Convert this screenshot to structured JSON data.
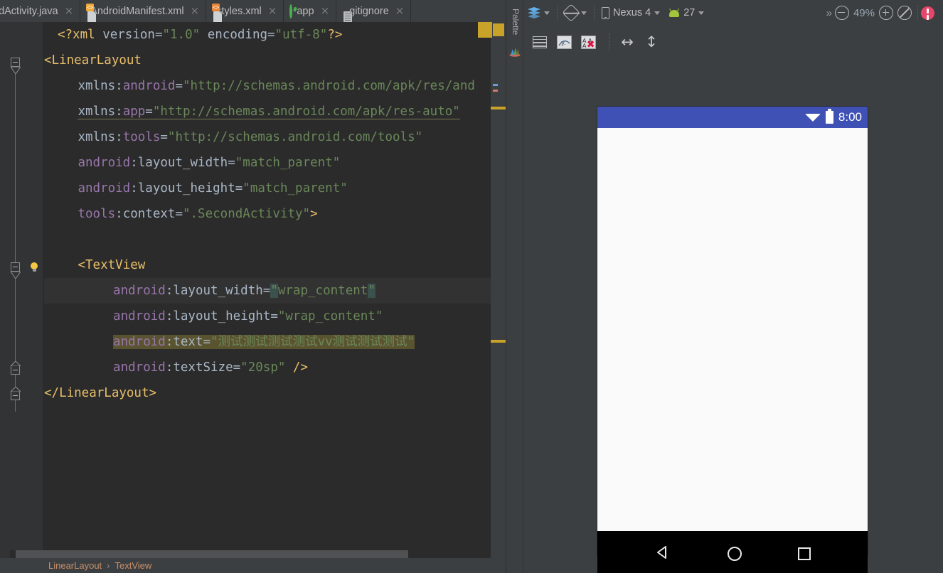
{
  "editor": {
    "tabs": [
      {
        "label": "ndActivity.java",
        "icon": "java-file-icon",
        "active": false,
        "truncated": true
      },
      {
        "label": "AndroidManifest.xml",
        "icon": "android-manifest-icon",
        "active": false
      },
      {
        "label": "styles.xml",
        "icon": "xml-resource-icon",
        "active": false
      },
      {
        "label": "app",
        "icon": "android-app-module-icon",
        "active": false
      },
      {
        "label": ".gitignore",
        "icon": "gitignore-file-icon",
        "active": false
      }
    ],
    "close_glyph": "×",
    "breadcrumb": {
      "items": [
        "LinearLayout",
        "TextView"
      ],
      "separator": "›"
    },
    "code_lines": [
      {
        "indent": 1,
        "segments": [
          {
            "t": "<?xml ",
            "c": "tag"
          },
          {
            "t": "version=",
            "c": "plain"
          },
          {
            "t": "\"1.0\"",
            "c": "str"
          },
          {
            "t": " encoding=",
            "c": "plain"
          },
          {
            "t": "\"utf-8\"",
            "c": "str"
          },
          {
            "t": "?>",
            "c": "tag"
          }
        ]
      },
      {
        "indent": 0,
        "segments": [
          {
            "t": "<LinearLayout",
            "c": "tag"
          }
        ]
      },
      {
        "indent": 2,
        "segments": [
          {
            "t": "xmlns:",
            "c": "plain"
          },
          {
            "t": "android",
            "c": "attr"
          },
          {
            "t": "=",
            "c": "plain"
          },
          {
            "t": "\"http://schemas.android.com/apk/res/and",
            "c": "str"
          }
        ]
      },
      {
        "indent": 2,
        "underline": "solid",
        "segments": [
          {
            "t": "xmlns:",
            "c": "plain"
          },
          {
            "t": "app",
            "c": "attr"
          },
          {
            "t": "=",
            "c": "plain"
          },
          {
            "t": "\"http://schemas.android.com/apk/res-auto\"",
            "c": "str"
          }
        ]
      },
      {
        "indent": 2,
        "segments": [
          {
            "t": "xmlns:",
            "c": "plain"
          },
          {
            "t": "tools",
            "c": "attr"
          },
          {
            "t": "=",
            "c": "plain"
          },
          {
            "t": "\"http://schemas.android.com/tools\"",
            "c": "str"
          }
        ]
      },
      {
        "indent": 2,
        "segments": [
          {
            "t": "android",
            "c": "attr"
          },
          {
            "t": ":layout_width=",
            "c": "plain"
          },
          {
            "t": "\"match_parent\"",
            "c": "str"
          }
        ]
      },
      {
        "indent": 2,
        "segments": [
          {
            "t": "android",
            "c": "attr"
          },
          {
            "t": ":layout_height=",
            "c": "plain"
          },
          {
            "t": "\"match_parent\"",
            "c": "str"
          }
        ]
      },
      {
        "indent": 2,
        "segments": [
          {
            "t": "tools",
            "c": "attr"
          },
          {
            "t": ":context=",
            "c": "plain"
          },
          {
            "t": "\".SecondActivity\"",
            "c": "str"
          },
          {
            "t": ">",
            "c": "tag"
          }
        ]
      },
      {
        "indent": 0,
        "segments": []
      },
      {
        "indent": 2,
        "bulb": true,
        "segments": [
          {
            "t": "<TextView",
            "c": "tag"
          }
        ]
      },
      {
        "indent": 3,
        "rowhl": "line",
        "segments": [
          {
            "t": "android",
            "c": "attr"
          },
          {
            "t": ":layout_width=",
            "c": "plain"
          },
          {
            "t": "\"",
            "c": "str",
            "hl": "brace"
          },
          {
            "t": "wrap_content",
            "c": "str"
          },
          {
            "t": "\"",
            "c": "str",
            "hl": "brace"
          }
        ]
      },
      {
        "indent": 3,
        "segments": [
          {
            "t": "android",
            "c": "attr"
          },
          {
            "t": ":layout_height=",
            "c": "plain"
          },
          {
            "t": "\"wrap_content\"",
            "c": "str"
          }
        ]
      },
      {
        "indent": 3,
        "rowhl": "warn",
        "segments": [
          {
            "t": "android",
            "c": "attr"
          },
          {
            "t": ":text=",
            "c": "plain"
          },
          {
            "t": "\"测试测试测试测试vv测试测试测试\"",
            "c": "str"
          }
        ]
      },
      {
        "indent": 3,
        "segments": [
          {
            "t": "android",
            "c": "attr"
          },
          {
            "t": ":textSize=",
            "c": "plain"
          },
          {
            "t": "\"20sp\"",
            "c": "str"
          },
          {
            "t": " />",
            "c": "tag"
          }
        ]
      },
      {
        "indent": 0,
        "segments": [
          {
            "t": "</LinearLayout>",
            "c": "tag"
          }
        ]
      }
    ]
  },
  "design": {
    "palette_label": "Palette",
    "toolbar": {
      "design_mode_icon": "layers-icon",
      "orientation_icon": "rotate-device-icon",
      "device_icon": "phone-icon",
      "device_name": "Nexus 4",
      "api_icon": "android-icon",
      "api_level": "27",
      "overflow_glyph": "»",
      "zoom_out_icon": "zoom-out-icon",
      "zoom_level": "49%",
      "zoom_in_icon": "zoom-in-icon",
      "zoom_fit_icon": "zoom-fit-icon",
      "error_badge_icon": "error-badge-icon"
    },
    "toolbar2": {
      "show_layout_decorations_icon": "layout-decorations-icon",
      "blueprint_icon": "blueprint-mode-icon",
      "blueprint_off_icon": "blueprint-off-icon",
      "match_width_icon": "expand-horizontal-icon",
      "match_height_icon": "expand-vertical-icon"
    },
    "preview": {
      "status_bar": {
        "wifi_icon": "wifi-icon",
        "battery_icon": "battery-icon",
        "time": "8:00",
        "bg_color": "#3f51b5"
      },
      "nav_bar": {
        "back_icon": "nav-back-icon",
        "home_icon": "nav-home-icon",
        "recents_icon": "nav-recents-icon",
        "bg_color": "#000000"
      },
      "content_bg": "#fafafa"
    }
  },
  "colors": {
    "editor_bg": "#2b2b2b",
    "chrome_bg": "#3c3f41",
    "gutter_bg": "#313335",
    "accent_blue": "#61b0ea",
    "error_pink": "#e8456b",
    "warn_highlight": "#5a5330",
    "brace_highlight": "#3b514d"
  }
}
